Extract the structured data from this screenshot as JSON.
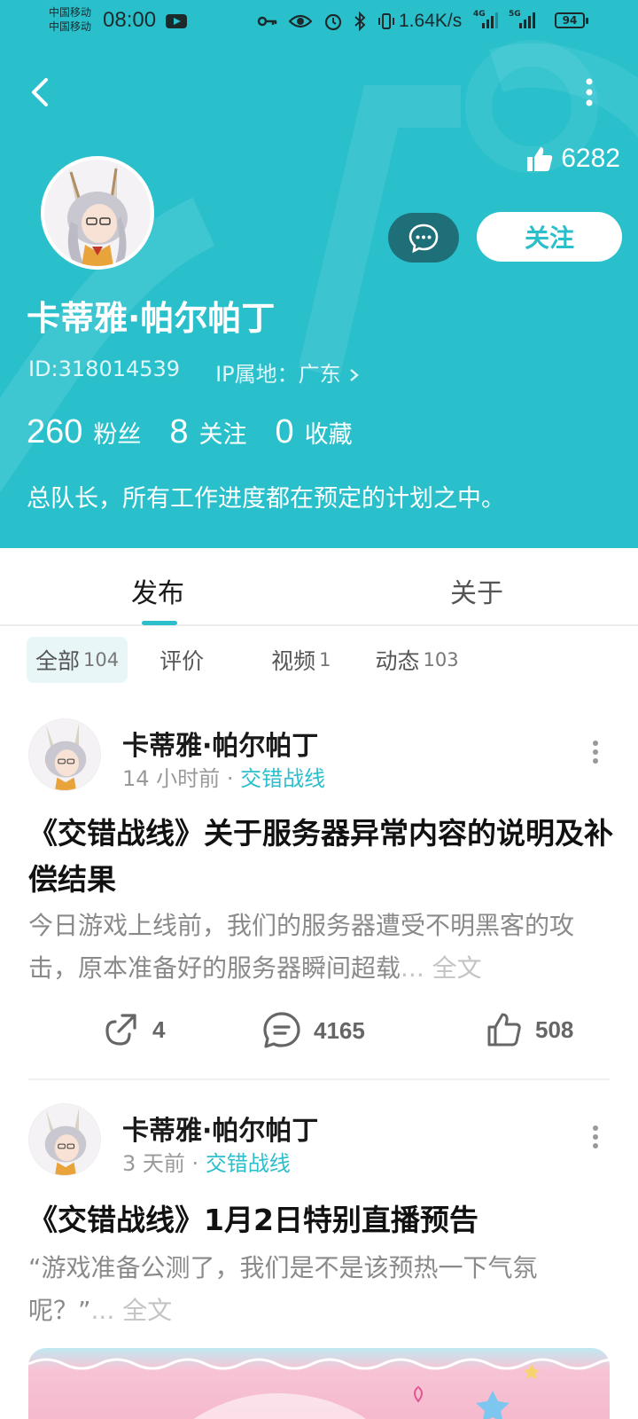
{
  "status_bar": {
    "carrier_1": "中国移动",
    "carrier_2": "中国移动",
    "time": "08:00",
    "net_speed": "1.64K/s",
    "sig1_tag": "4G",
    "sig2_tag": "5G",
    "battery": "94"
  },
  "profile": {
    "likes": "6282",
    "message_icon": "chat-bubble-icon",
    "follow_label": "关注",
    "name": "卡蒂雅·帕尔帕丁",
    "id_text": "ID:318014539",
    "ip_text": "IP属地：广东",
    "stats": [
      {
        "num": "260",
        "label": "粉丝"
      },
      {
        "num": "8",
        "label": "关注"
      },
      {
        "num": "0",
        "label": "收藏"
      }
    ],
    "bio": "总队长，所有工作进度都在预定的计划之中。"
  },
  "tabs": {
    "publish": "发布",
    "about": "关于"
  },
  "filters": [
    {
      "label": "全部",
      "count": "104"
    },
    {
      "label": "评价",
      "count": ""
    },
    {
      "label": "视频",
      "count": "1"
    },
    {
      "label": "动态",
      "count": "103"
    }
  ],
  "posts": [
    {
      "author": "卡蒂雅·帕尔帕丁",
      "time": "14 小时前",
      "game": "交错战线",
      "title": "《交错战线》关于服务器异常内容的说明及补偿结果",
      "excerpt": "今日游戏上线前，我们的服务器遭受不明黑客的攻击，原本准备好的服务器瞬间超载",
      "more": "... 全文",
      "shares": "4",
      "comments": "4165",
      "likes": "508"
    },
    {
      "author": "卡蒂雅·帕尔帕丁",
      "time": "3 天前",
      "game": "交错战线",
      "title": "《交错战线》1月2日特别直播预告",
      "excerpt": "“游戏准备公测了，我们是不是该预热一下气氛呢？”",
      "more": "... 全文"
    }
  ],
  "colors": {
    "header": "#29c0cc",
    "accent": "#2bbfcb",
    "message_button": "#1f6f79"
  }
}
